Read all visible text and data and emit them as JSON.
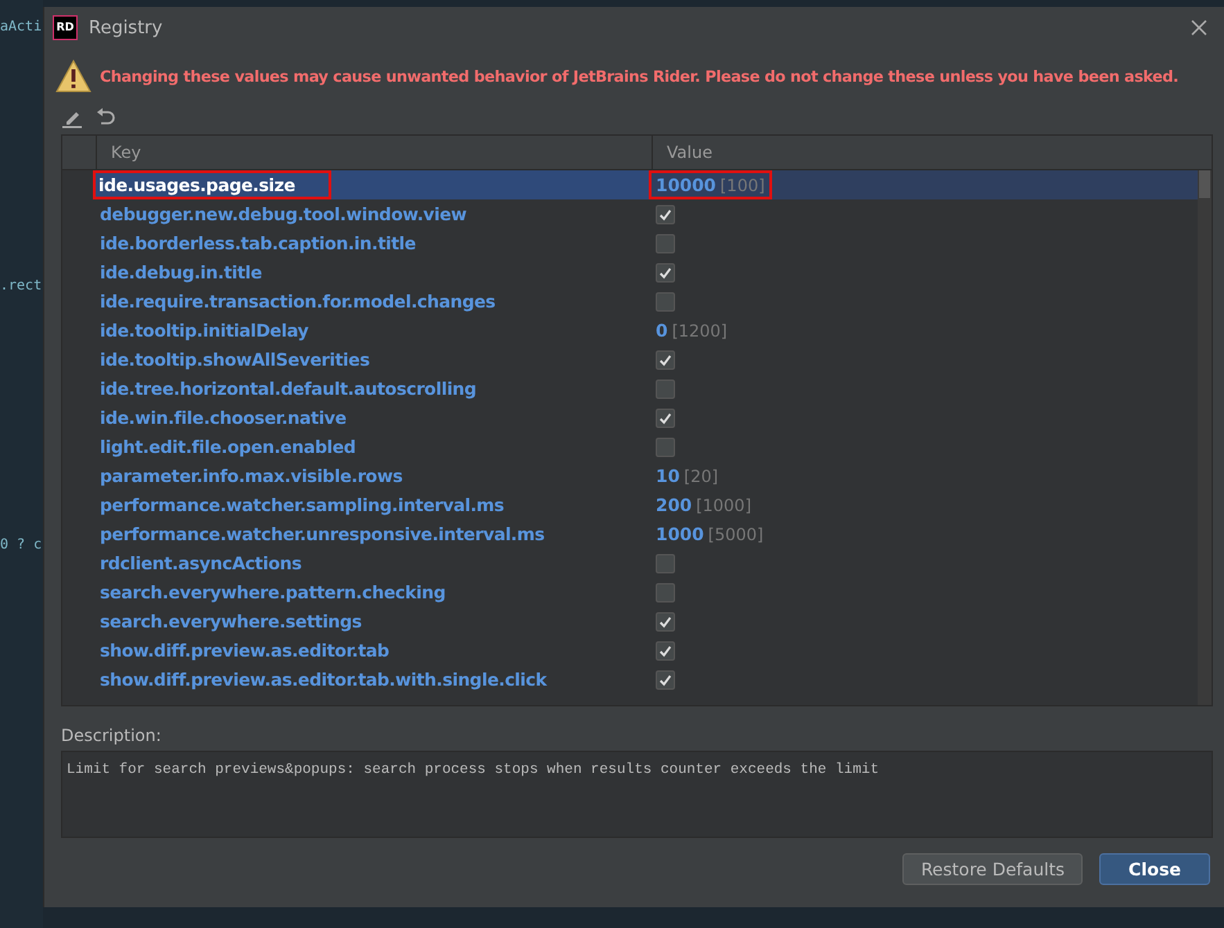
{
  "background_editor": {
    "fragments": [
      "aActi",
      ".rect",
      "0 ? c"
    ]
  },
  "window": {
    "title": "Registry",
    "app_badge": "RD"
  },
  "warning": "Changing these values may cause unwanted behavior of JetBrains Rider. Please do not change these unless you have been asked.",
  "table": {
    "columns": [
      "Key",
      "Value"
    ],
    "rows": [
      {
        "key": "ide.usages.page.size",
        "kind": "number",
        "value": "10000",
        "default": "[100]",
        "selected": true,
        "annotated": true
      },
      {
        "key": "debugger.new.debug.tool.window.view",
        "kind": "checkbox",
        "checked": true,
        "selected": false,
        "annotated": false
      },
      {
        "key": "ide.borderless.tab.caption.in.title",
        "kind": "checkbox",
        "checked": false,
        "selected": false,
        "annotated": false
      },
      {
        "key": "ide.debug.in.title",
        "kind": "checkbox",
        "checked": true,
        "selected": false,
        "annotated": false
      },
      {
        "key": "ide.require.transaction.for.model.changes",
        "kind": "checkbox",
        "checked": false,
        "selected": false,
        "annotated": false
      },
      {
        "key": "ide.tooltip.initialDelay",
        "kind": "number",
        "value": "0",
        "default": "[1200]",
        "selected": false,
        "annotated": false
      },
      {
        "key": "ide.tooltip.showAllSeverities",
        "kind": "checkbox",
        "checked": true,
        "selected": false,
        "annotated": false
      },
      {
        "key": "ide.tree.horizontal.default.autoscrolling",
        "kind": "checkbox",
        "checked": false,
        "selected": false,
        "annotated": false
      },
      {
        "key": "ide.win.file.chooser.native",
        "kind": "checkbox",
        "checked": true,
        "selected": false,
        "annotated": false
      },
      {
        "key": "light.edit.file.open.enabled",
        "kind": "checkbox",
        "checked": false,
        "selected": false,
        "annotated": false
      },
      {
        "key": "parameter.info.max.visible.rows",
        "kind": "number",
        "value": "10",
        "default": "[20]",
        "selected": false,
        "annotated": false
      },
      {
        "key": "performance.watcher.sampling.interval.ms",
        "kind": "number",
        "value": "200",
        "default": "[1000]",
        "selected": false,
        "annotated": false
      },
      {
        "key": "performance.watcher.unresponsive.interval.ms",
        "kind": "number",
        "value": "1000",
        "default": "[5000]",
        "selected": false,
        "annotated": false
      },
      {
        "key": "rdclient.asyncActions",
        "kind": "checkbox",
        "checked": false,
        "selected": false,
        "annotated": false
      },
      {
        "key": "search.everywhere.pattern.checking",
        "kind": "checkbox",
        "checked": false,
        "selected": false,
        "annotated": false
      },
      {
        "key": "search.everywhere.settings",
        "kind": "checkbox",
        "checked": true,
        "selected": false,
        "annotated": false
      },
      {
        "key": "show.diff.preview.as.editor.tab",
        "kind": "checkbox",
        "checked": true,
        "selected": false,
        "annotated": false
      },
      {
        "key": "show.diff.preview.as.editor.tab.with.single.click",
        "kind": "checkbox",
        "checked": true,
        "selected": false,
        "annotated": false
      }
    ]
  },
  "description": {
    "label": "Description:",
    "text": "Limit for search previews&popups: search process stops when results counter exceeds the limit"
  },
  "buttons": [
    {
      "label": "Restore Defaults",
      "default": false
    },
    {
      "label": "Close",
      "default": true
    }
  ]
}
